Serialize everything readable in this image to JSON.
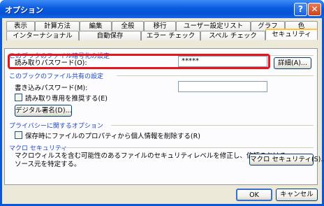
{
  "window": {
    "title": "オプション",
    "help_glyph": "?",
    "close_glyph": "✕"
  },
  "tabs_row1": [
    "表示",
    "計算方法",
    "編集",
    "全般",
    "移行",
    "ユーザー設定リスト",
    "グラフ",
    "色"
  ],
  "tabs_row2": [
    "インターナショナル",
    "自動保存",
    "エラー チェック",
    "スペル チェック",
    "セキュリティ"
  ],
  "active_tab": "セキュリティ",
  "encryption_section": {
    "title": "このブックのファイル暗号化の設定",
    "read_password_label": "読み取りパスワード(O):",
    "read_password_value": "*****",
    "advanced_button": "詳細(A)..."
  },
  "sharing_section": {
    "title": "このブックのファイル共有の設定",
    "write_password_label": "書き込みパスワード(M):",
    "write_password_value": "",
    "readonly_recommended_label": "読み取り専用を推奨する(E)",
    "readonly_recommended_checked": false,
    "digital_signature_button": "デジタル署名(D)..."
  },
  "privacy_section": {
    "title": "プライバシーに関するオプション",
    "remove_personal_info_label": "保存時にファイルのプロパティから個人情報を削除する(R)",
    "remove_personal_info_checked": false
  },
  "macro_section": {
    "title": "マクロ セキュリティ",
    "description_line1": "マクロウィルスを含む可能性のあるファイルのセキュリティレベルを修正し、信頼のおける",
    "description_line2": "ソース元を特定する。",
    "macro_security_button": "マクロ セキュリティ(S)..."
  },
  "footer": {
    "ok_button": "OK",
    "cancel_button": "キャンセル"
  }
}
